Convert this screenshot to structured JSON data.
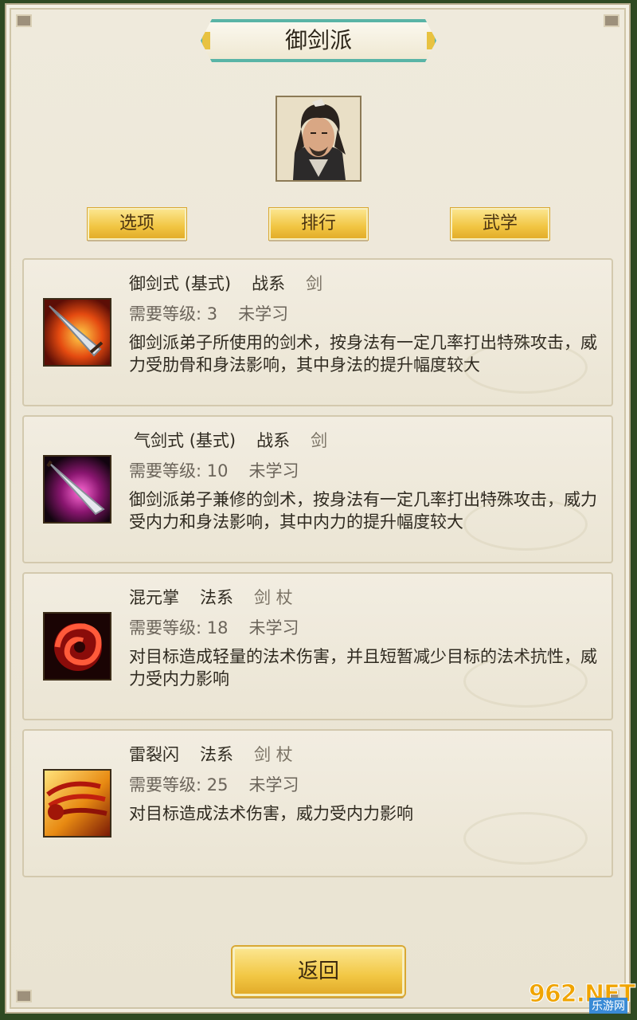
{
  "title": "御剑派",
  "tabs": [
    {
      "label": "选项"
    },
    {
      "label": "排行"
    },
    {
      "label": "武学"
    }
  ],
  "skills": [
    {
      "name": "御剑式",
      "kind": "(基式)",
      "school": "战系",
      "weapons": "剑",
      "level_label": "需要等级: 3",
      "status": "未学习",
      "description": "御剑派弟子所使用的剑术，按身法有一定几率打出特殊攻击，威力受肋骨和身法影响，其中身法的提升幅度较大",
      "icon": "sword-slash-icon"
    },
    {
      "name": "气剑式",
      "kind": "(基式)",
      "school": "战系",
      "weapons": "剑",
      "level_label": "需要等级: 10",
      "status": "未学习",
      "description": "御剑派弟子兼修的剑术，按身法有一定几率打出特殊攻击，威力受内力和身法影响，其中内力的提升幅度较大",
      "icon": "qi-sword-icon"
    },
    {
      "name": "混元掌",
      "kind": "",
      "school": "法系",
      "weapons": "剑 杖",
      "level_label": "需要等级: 18",
      "status": "未学习",
      "description": "对目标造成轻量的法术伤害，并且短暂减少目标的法术抗性，威力受内力影响",
      "icon": "red-vortex-icon"
    },
    {
      "name": "雷裂闪",
      "kind": "",
      "school": "法系",
      "weapons": "剑 杖",
      "level_label": "需要等级: 25",
      "status": "未学习",
      "description": "对目标造成法术伤害，威力受内力影响",
      "icon": "thunder-flash-icon"
    }
  ],
  "back_label": "返回",
  "watermark": {
    "main": "962.NET",
    "sub": "乐游网"
  },
  "colors": {
    "accent_gold": "#f1c542",
    "banner_teal": "#59b4a6",
    "panel": "#ebe5d4"
  }
}
